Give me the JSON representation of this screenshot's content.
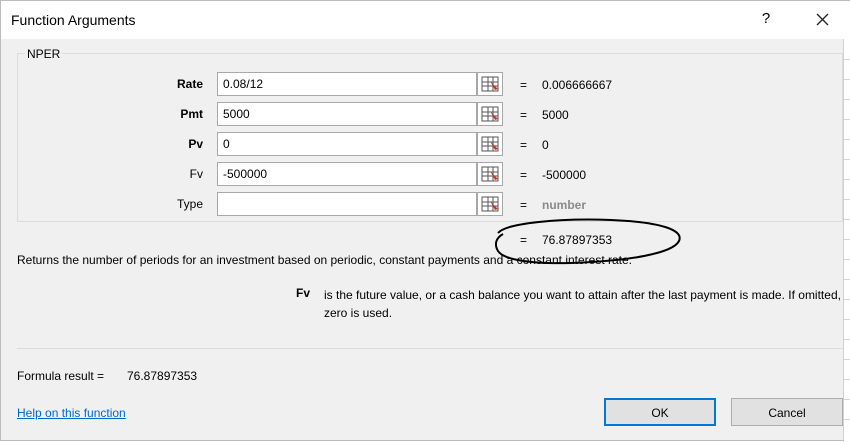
{
  "window": {
    "title": "Function Arguments",
    "help_label": "?"
  },
  "function": {
    "name": "NPER",
    "args": [
      {
        "label": "Rate",
        "value": "0.08/12",
        "result": "0.006666667",
        "bold": true
      },
      {
        "label": "Pmt",
        "value": "5000",
        "result": "5000",
        "bold": true
      },
      {
        "label": "Pv",
        "value": "0",
        "result": "0",
        "bold": true
      },
      {
        "label": "Fv",
        "value": "-500000",
        "result": "-500000",
        "bold": false
      },
      {
        "label": "Type",
        "value": "",
        "result": "number",
        "bold": false
      }
    ],
    "equals": "=",
    "overall_result": "76.87897353",
    "description": "Returns the number of periods for an investment based on periodic, constant payments and a constant interest rate.",
    "param_name": "Fv",
    "param_description": "is the future value, or a cash balance you want to attain after the last payment is made. If omitted, zero is used."
  },
  "formula_result": {
    "label": "Formula result =",
    "value": "76.87897353"
  },
  "help_link": "Help on this function",
  "buttons": {
    "ok": "OK",
    "cancel": "Cancel"
  },
  "icons": {
    "help": "help-icon",
    "close": "close-icon",
    "range": "collapse-dialog-icon"
  },
  "colors": {
    "accent": "#0078d7",
    "link": "#0066cc",
    "annotation": "#000000"
  }
}
